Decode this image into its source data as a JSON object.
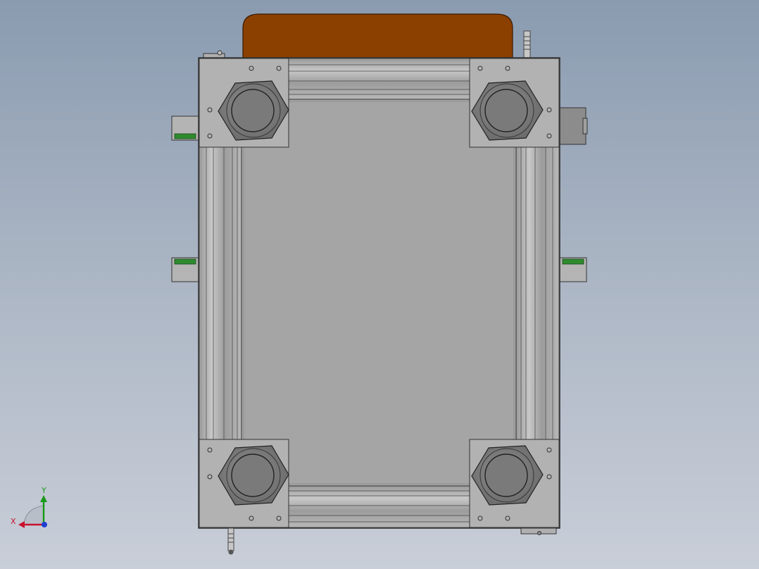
{
  "viewport": {
    "background_top": "#8a9bb0",
    "background_bottom": "#c9ced8"
  },
  "model": {
    "top_cover_color": "#8b4000",
    "frame_color": "#a4a4a4",
    "plate_color": "#a5a5a5",
    "nut_color": "#787878",
    "accent_green": "#2e8b2e"
  },
  "triad": {
    "x_label": "X",
    "y_label": "Y",
    "x_color": "#c8102e",
    "y_color": "#1a9a1a",
    "z_color": "#1f3fd0"
  }
}
